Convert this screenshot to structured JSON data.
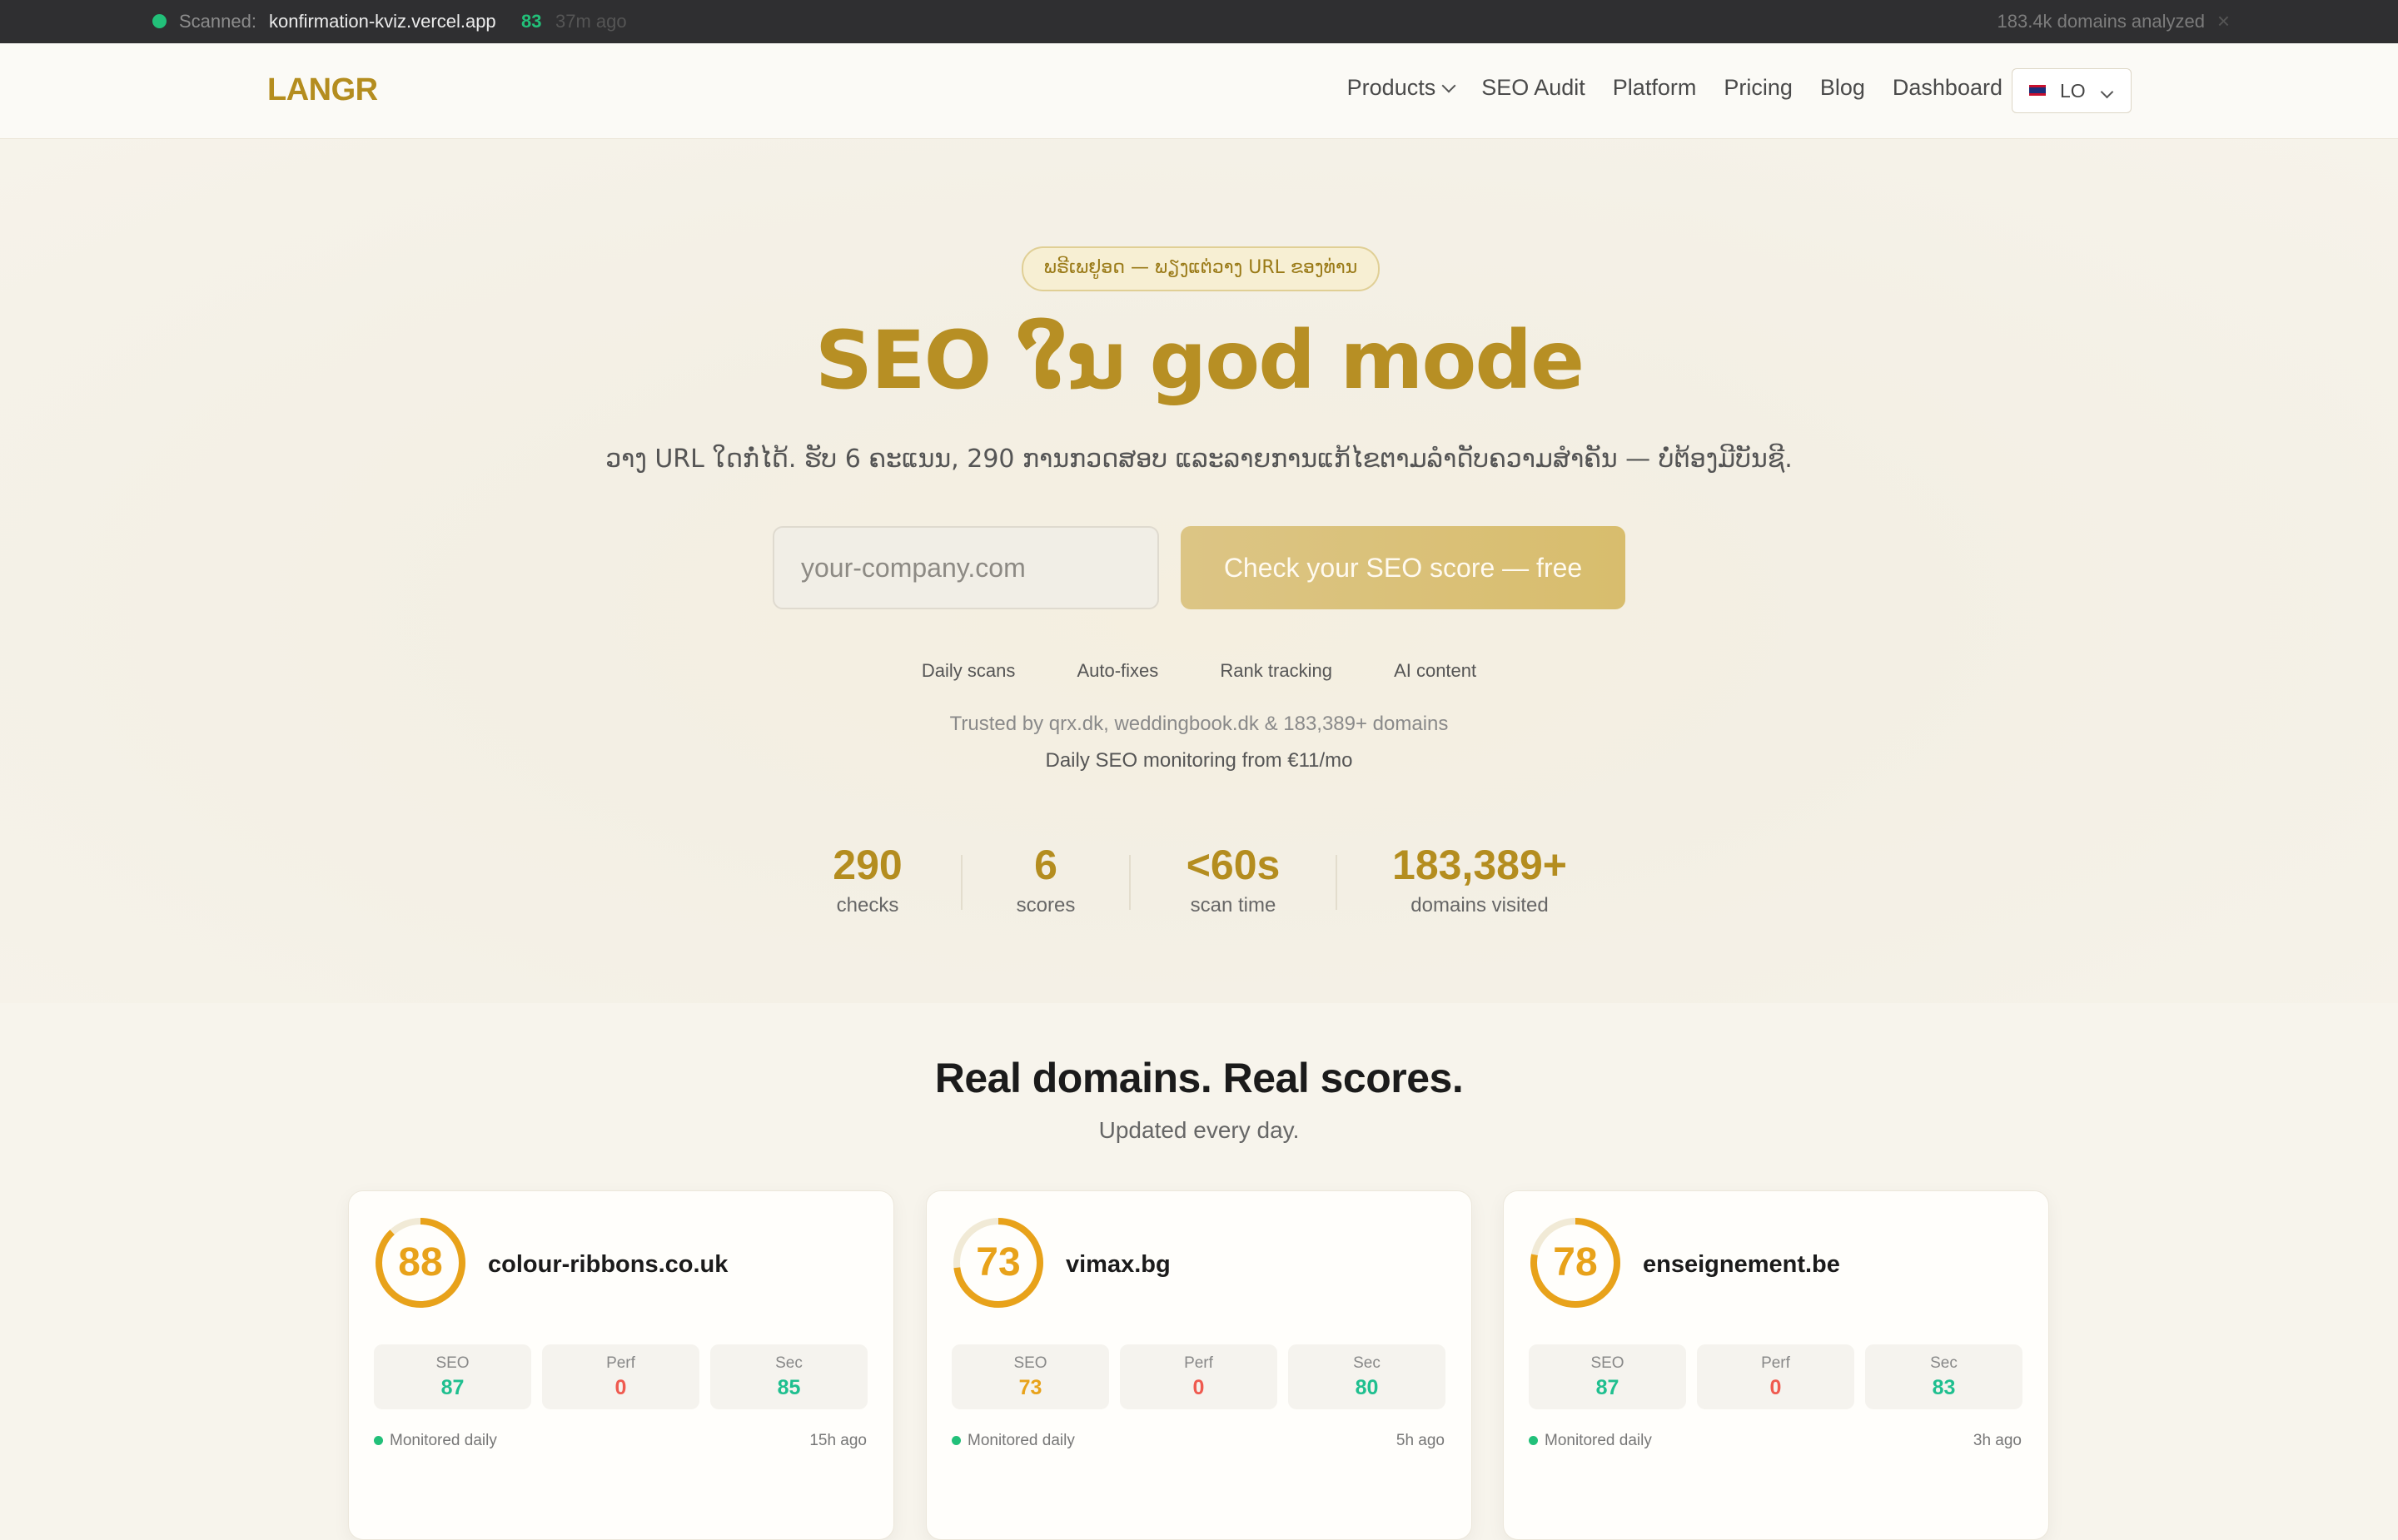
{
  "scanbar": {
    "label": "Scanned:",
    "domain": "konfirmation-kviz.vercel.app",
    "score": "83",
    "ago": "37m ago",
    "count": "183.4k domains analyzed",
    "close": "×"
  },
  "nav": {
    "logo": "LANGR",
    "links": [
      "Products",
      "SEO Audit",
      "Platform",
      "Pricing",
      "Blog",
      "Dashboard"
    ],
    "lang": "LO"
  },
  "hero": {
    "pill": "ພຣີເພຢູອດ — ພຽງແຕ່ວາງ URL ຂອງທ່ານ",
    "headline": "SEO ໃນ god mode",
    "subtitle": "ວາງ URL ໃດກໍ່ໄດ້. ຮັບ 6 ຄະແນນ, 290 ການກວດສອບ ແລະລາຍການແກ້ໄຂຕາມລໍາດັບຄວາມສໍາຄັນ — ບໍ່ຕ້ອງມີບັນຊີ.",
    "input_placeholder": "your-company.com",
    "cta": "Check your SEO score — free",
    "features": [
      "Daily scans",
      "Auto-fixes",
      "Rank tracking",
      "AI content"
    ],
    "trusted": "Trusted by qrx.dk, weddingbook.dk & 183,389+ domains",
    "pricing": "Daily SEO monitoring from €11/mo"
  },
  "stats": [
    {
      "num": "290",
      "label": "checks"
    },
    {
      "num": "6",
      "label": "scores"
    },
    {
      "num": "<60s",
      "label": "scan time"
    },
    {
      "num": "183,389+",
      "label": "domains visited"
    }
  ],
  "proof": {
    "title": "Real domains. Real scores.",
    "subtitle": "Updated every day."
  },
  "cards": [
    {
      "score": "88",
      "score_fraction": 0.88,
      "domain": "colour-ribbons.co.uk",
      "metrics": [
        {
          "label": "SEO",
          "value": "87",
          "color": "#1fbf8f"
        },
        {
          "label": "Perf",
          "value": "0",
          "color": "#ef5a4f"
        },
        {
          "label": "Sec",
          "value": "85",
          "color": "#1fbf8f"
        }
      ],
      "monitored": "Monitored daily",
      "ago": "15h ago"
    },
    {
      "score": "73",
      "score_fraction": 0.73,
      "domain": "vimax.bg",
      "metrics": [
        {
          "label": "SEO",
          "value": "73",
          "color": "#e8a21a"
        },
        {
          "label": "Perf",
          "value": "0",
          "color": "#ef5a4f"
        },
        {
          "label": "Sec",
          "value": "80",
          "color": "#1fbf8f"
        }
      ],
      "monitored": "Monitored daily",
      "ago": "5h ago"
    },
    {
      "score": "78",
      "score_fraction": 0.78,
      "domain": "enseignement.be",
      "metrics": [
        {
          "label": "SEO",
          "value": "87",
          "color": "#1fbf8f"
        },
        {
          "label": "Perf",
          "value": "0",
          "color": "#ef5a4f"
        },
        {
          "label": "Sec",
          "value": "83",
          "color": "#1fbf8f"
        }
      ],
      "monitored": "Monitored daily",
      "ago": "3h ago"
    }
  ],
  "colors": {
    "brand": "#b48d1f",
    "good": "#22c079",
    "bad": "#ef5a4f",
    "mid": "#e8a21a"
  }
}
